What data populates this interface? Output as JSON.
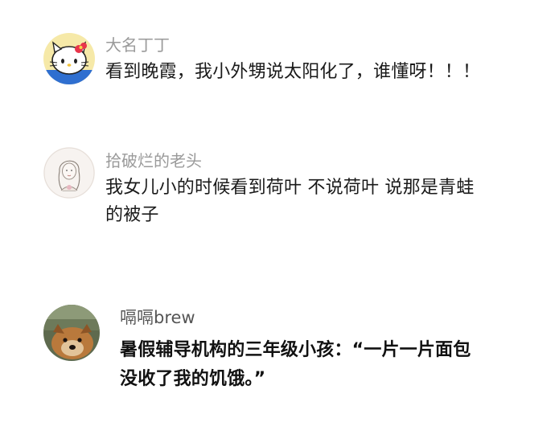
{
  "comments": [
    {
      "username": "大名丁丁",
      "avatar_icon": "hello-kitty-avatar",
      "text": "看到晚霞，我小外甥说太阳化了，谁懂呀！！！"
    },
    {
      "username": "拾破烂的老头",
      "avatar_icon": "sketch-girl-avatar",
      "text_line1": "我女儿小的时候看到荷叶 不说荷叶 说那是青蛙",
      "text_line2": "的被子"
    },
    {
      "username": "嗝嗝brew",
      "avatar_icon": "dog-photo-avatar",
      "text_line1": "暑假辅导机构的三年级小孩：“一片一片面包",
      "text_line2": "没收了我的饥饿。”"
    }
  ]
}
